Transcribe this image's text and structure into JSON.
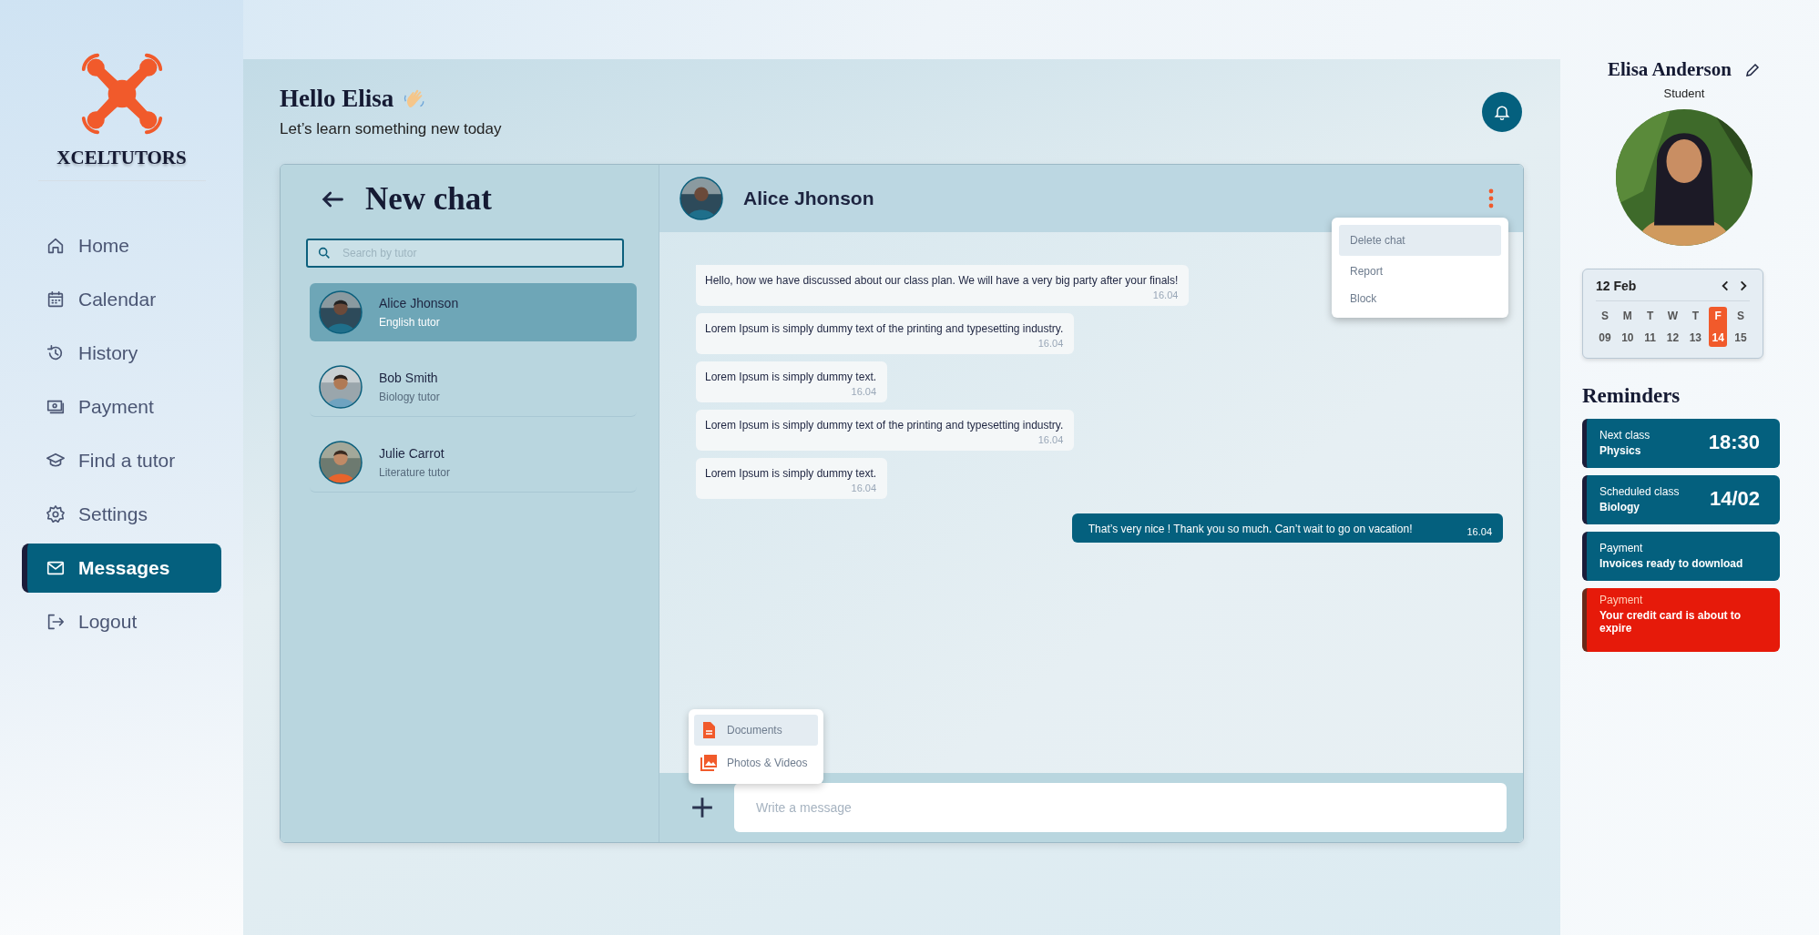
{
  "brand": {
    "name": "XCELTUTORS"
  },
  "nav": [
    {
      "label": "Home",
      "selected": false
    },
    {
      "label": "Calendar",
      "selected": false
    },
    {
      "label": "History",
      "selected": false
    },
    {
      "label": "Payment",
      "selected": false
    },
    {
      "label": "Find a tutor",
      "selected": false
    },
    {
      "label": "Settings",
      "selected": false
    },
    {
      "label": "Messages",
      "selected": true
    },
    {
      "label": "Logout",
      "selected": false
    }
  ],
  "header": {
    "greeting": "Hello Elisa",
    "subtitle": "Let’s learn something new today"
  },
  "chat_list": {
    "title": "New chat",
    "search": {
      "placeholder": "Search by tutor"
    },
    "chats": [
      {
        "name": "Alice Jhonson",
        "role": "English tutor",
        "selected": true
      },
      {
        "name": "Bob Smith",
        "role": "Biology tutor",
        "selected": false
      },
      {
        "name": "Julie Carrot",
        "role": "Literature tutor",
        "selected": false
      }
    ]
  },
  "conversation": {
    "name": "Alice Jhonson",
    "menu": [
      {
        "label": "Delete chat",
        "selected": true
      },
      {
        "label": "Report",
        "selected": false
      },
      {
        "label": "Block",
        "selected": false
      }
    ],
    "messages": [
      {
        "kind": "incoming",
        "text": "Hello, how we have discussed about our class plan. We will have a very big party after your finals!",
        "time": "16.04"
      },
      {
        "kind": "incoming",
        "text": "Lorem Ipsum is simply dummy text of the printing and typesetting industry.",
        "time": "16.04"
      },
      {
        "kind": "incoming",
        "text": "Lorem Ipsum is simply dummy text.",
        "time": "16.04"
      },
      {
        "kind": "incoming",
        "text": "Lorem Ipsum is simply dummy text of the printing and typesetting industry.",
        "time": "16.04"
      },
      {
        "kind": "incoming",
        "text": "Lorem Ipsum is simply dummy text.",
        "time": "16.04"
      },
      {
        "kind": "outgoing",
        "text": "That’s very nice ! Thank you so much. Can’t wait to go on vacation!",
        "time": "16.04"
      }
    ],
    "attach_menu": [
      {
        "label": "Documents",
        "selected": true
      },
      {
        "label": "Photos & Videos",
        "selected": false
      }
    ],
    "input": {
      "placeholder": "Write a message"
    }
  },
  "profile": {
    "name": "Elisa Anderson",
    "role": "Student"
  },
  "calendar": {
    "month": "12 Feb",
    "days": [
      {
        "letter": "S",
        "date": "09",
        "selected": false
      },
      {
        "letter": "M",
        "date": "10",
        "selected": false
      },
      {
        "letter": "T",
        "date": "11",
        "selected": false
      },
      {
        "letter": "W",
        "date": "12",
        "selected": false
      },
      {
        "letter": "T",
        "date": "13",
        "selected": false
      },
      {
        "letter": "F",
        "date": "14",
        "selected": true
      },
      {
        "letter": "S",
        "date": "15",
        "selected": false
      }
    ]
  },
  "reminders": {
    "title": "Reminders",
    "items": [
      {
        "kind": "info",
        "label": "Next class",
        "detail": "Physics",
        "value": "18:30"
      },
      {
        "kind": "info",
        "label": "Scheduled class",
        "detail": "Biology",
        "value": "14/02"
      },
      {
        "kind": "info",
        "label": "Payment",
        "detail": "Invoices ready to download"
      },
      {
        "kind": "alert",
        "label": "Payment",
        "detail": "Your credit card is about to expire"
      }
    ]
  }
}
